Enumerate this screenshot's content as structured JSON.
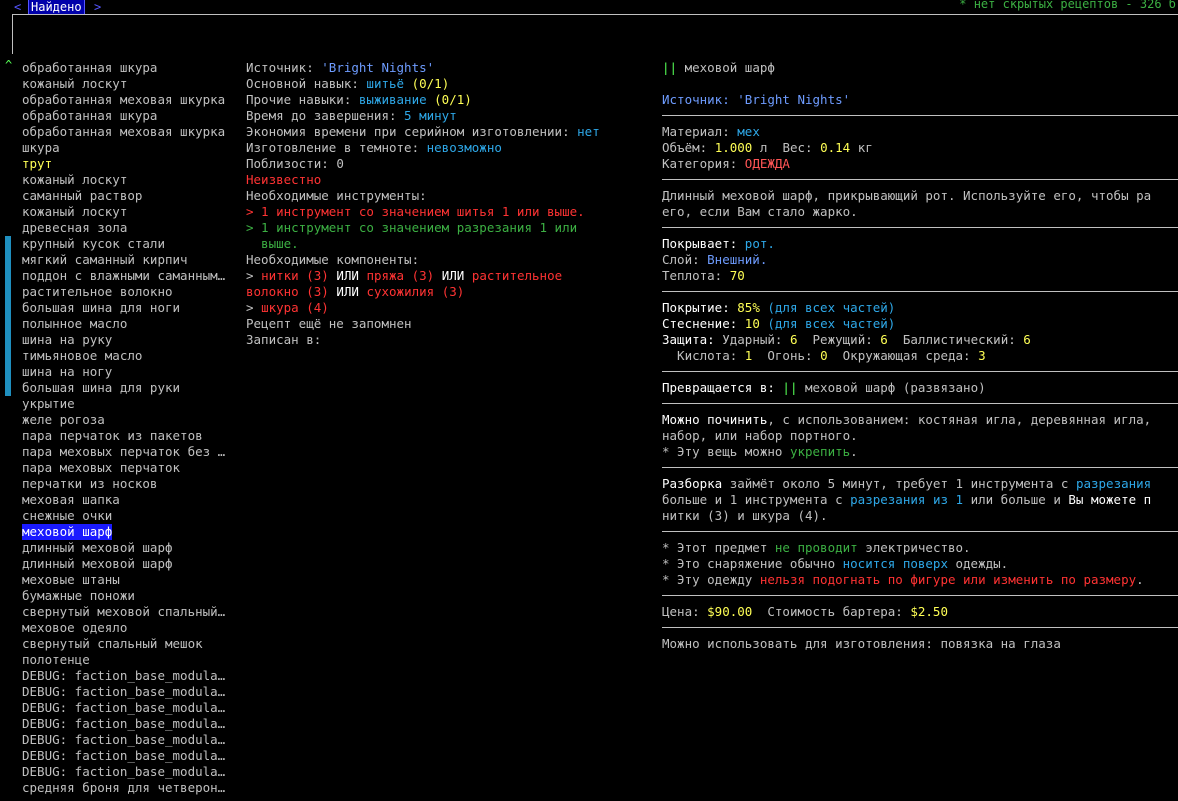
{
  "topbar": {
    "prev_arrow": "<",
    "found_tab": "Найдено",
    "next_arrow": ">",
    "hidden_info": "* нет скрытых рецептов - 326 б"
  },
  "scroll_up_glyph": "^",
  "recipes": [
    "обработанная шкура",
    "кожаный лоскут",
    "обработанная меховая шкурка",
    "обработанная шкура",
    "обработанная меховая шкурка",
    "шкура",
    "трут",
    "кожаный лоскут",
    "саманный раствор",
    "кожаный лоскут",
    "древесная зола",
    "крупный кусок стали",
    "мягкий саманный кирпич",
    "поддон с влажными саманным…",
    "растительное волокно",
    "большая шина для ноги",
    "полынное масло",
    "шина на руку",
    "тимьяновое масло",
    "шина на ногу",
    "большая шина для руки",
    "укрытие",
    "желе рогоза",
    "пара перчаток из пакетов",
    "пара меховых перчаток без …",
    "пара меховых перчаток",
    "перчатки из носков",
    "меховая шапка",
    "снежные очки",
    "меховой шарф",
    "длинный меховой шарф",
    "длинный меховой шарф",
    "меховые штаны",
    "бумажные поножи",
    "свернутый меховой спальный…",
    "меховое одеяло",
    "свернутый спальный мешок",
    "полотенце",
    "DEBUG: faction_base_modula…",
    "DEBUG: faction_base_modula…",
    "DEBUG: faction_base_modula…",
    "DEBUG: faction_base_modula…",
    "DEBUG: faction_base_modula…",
    "DEBUG: faction_base_modula…",
    "DEBUG: faction_base_modula…",
    "средняя броня для четверон…"
  ],
  "details": {
    "source_label": "Источник: ",
    "source_value": "'Bright Nights'",
    "primary_skill_label": "Основной навык: ",
    "primary_skill_value": "шитьё",
    "primary_skill_level": " (0/1)",
    "other_skills_label": "Прочие навыки: ",
    "other_skills_value": "выживание",
    "other_skills_level": " (0/1)",
    "time_label": "Время до завершения: ",
    "time_value": "5 минут",
    "batch_label": "Экономия времени при серийном изготовлении: ",
    "batch_value": "нет",
    "dark_label": "Изготовление в темноте: ",
    "dark_value": "невозможно",
    "nearby_label": "Поблизости: ",
    "nearby_value": "0",
    "unknown": "Неизвестно",
    "tools_label": "Необходимые инструменты:",
    "tool1": "> 1 инструмент со значением шитья 1 или выше.",
    "tool2_line1": "> 1 инструмент со значением разрезания 1 или",
    "tool2_line2": "  выше.",
    "components_label": "Необходимые компоненты:",
    "comp_arrow": "> ",
    "comp_a": "нитки (3)",
    "comp_or": " ИЛИ ",
    "comp_b": "пряжа (3)",
    "comp_c": "растительное",
    "comp_c2": "волокно (3)",
    "comp_d": "сухожилия (3)",
    "comp2_arrow": "> ",
    "comp2": "шкура (4)",
    "not_memorized": "Рецепт ещё не запомнен",
    "written_in": "Записан в:"
  },
  "item": {
    "name_prefix": "||",
    "name": " меховой шарф",
    "source_label": "Источник: ",
    "source_value": "'Bright Nights'",
    "material_label": "Материал: ",
    "material_value": "мех",
    "volume_label": "Объём: ",
    "volume_value": "1.000",
    "volume_unit": " л  ",
    "weight_label": "Вес: ",
    "weight_value": "0.14",
    "weight_unit": " кг",
    "category_label": "Категория: ",
    "category_value": "ОДЕЖДА",
    "desc1": "Длинный меховой шарф, прикрывающий рот. Используйте его, чтобы ра",
    "desc2": "его, если Вам стало жарко.",
    "covers_label": "Покрывает: ",
    "covers_value": "рот.",
    "layer_label": "Слой: ",
    "layer_value": "Внешний.",
    "warmth_label": "Теплота: ",
    "warmth_value": "70",
    "coverage_label": "Покрытие: ",
    "coverage_value": "85%",
    "coverage_note": " (для всех частей)",
    "encumbrance_label": "Стеснение: ",
    "encumbrance_value": "10",
    "encumbrance_note": " (для всех частей)",
    "protection_label": "Защита: ",
    "bash_label": "Ударный: ",
    "bash_value": "6",
    "cut_label": "  Режущий: ",
    "cut_value": "6",
    "ballistic_label": "  Баллистический: ",
    "ballistic_value": "6",
    "acid_label": "  Кислота: ",
    "acid_value": "1",
    "fire_label": "  Огонь: ",
    "fire_value": "0",
    "env_label": "  Окружающая среда: ",
    "env_value": "3",
    "turns_into_label": "Превращается в: ",
    "turns_into_prefix": "||",
    "turns_into_value": " меховой шарф (развязано)",
    "repair_label": "Можно починить",
    "repair_text": ", с использованием: костяная игла, деревянная игла,",
    "repair_text2": "набор, или набор портного.",
    "reinforce_prefix": "* Эту вещь можно ",
    "reinforce_value": "укрепить",
    "reinforce_suffix": ".",
    "disassembly_label": "Разборка",
    "disassembly_text1": " займёт около 5 минут, требует 1 инструмента с ",
    "disassembly_cut": "разрезания",
    "disassembly_text2a": "больше и 1 инструмента с ",
    "disassembly_cut2": "разрезания из 1",
    "disassembly_text2b": " или больше и ",
    "disassembly_text2c": "Вы можете п",
    "disassembly_text3": "нитки (3) и шкура (4).",
    "note1_prefix": "* Этот предмет ",
    "note1_value": "не проводит",
    "note1_suffix": " электричество.",
    "note2_prefix": "* Это снаряжение обычно ",
    "note2_value": "носится поверх",
    "note2_suffix": " одежды.",
    "note3_prefix": "* Эту одежду ",
    "note3_value": "нельзя подогнать по фигуре или изменить по размеру",
    "note3_suffix": ".",
    "price_label": "Цена: ",
    "price_value": "$90.00",
    "barter_label": "  Стоимость бартера: ",
    "barter_value": "$2.50",
    "craft_label": "Можно использовать для изготовления: ",
    "craft_value": "повязка на глаза"
  },
  "colors": {
    "selection_bg": "#1a1aff",
    "scrollbar": "#1f8fbf",
    "accent_blue": "#5555ff"
  },
  "selected_index": 29
}
